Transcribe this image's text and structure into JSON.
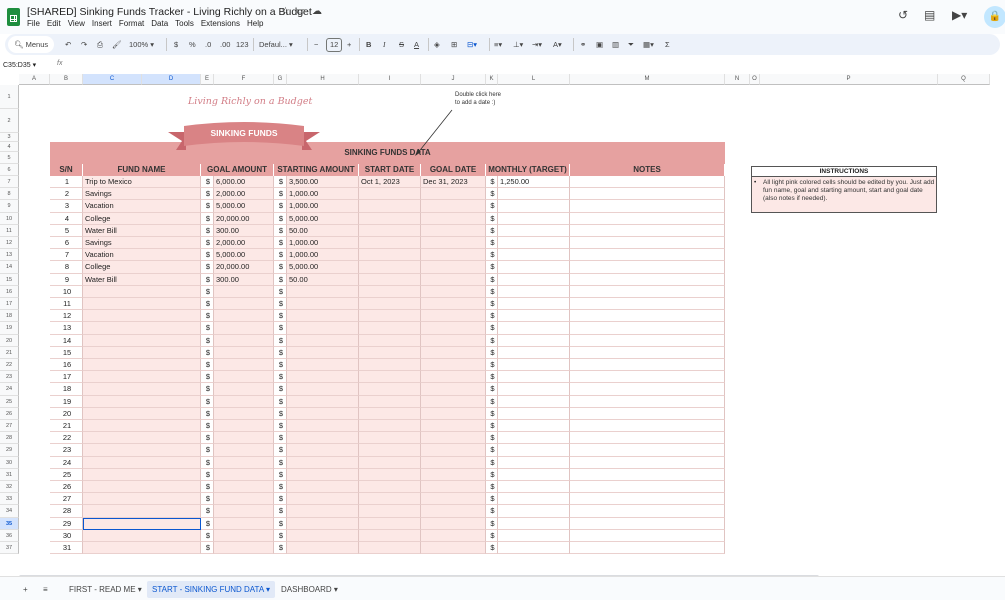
{
  "app": {
    "title": "[SHARED] Sinking Funds Tracker - Living Richly on a Budget",
    "menus": [
      "File",
      "Edit",
      "View",
      "Insert",
      "Format",
      "Data",
      "Tools",
      "Extensions",
      "Help"
    ]
  },
  "toolbar": {
    "menus_label": "Menus",
    "zoom": "100%",
    "currency": "$",
    "percent": "%",
    "dec_decrease": ".0",
    "dec_increase": ".00",
    "number_format": "123",
    "font": "Defaul...",
    "font_size": "12",
    "minus": "−",
    "plus": "+",
    "bold": "B",
    "italic": "I",
    "strike": "S",
    "text_color": "A",
    "sigma": "Σ"
  },
  "formula_bar": {
    "name_box": "C35:D35",
    "fx": "fx"
  },
  "columns": [
    "A",
    "B",
    "C",
    "D",
    "E",
    "F",
    "G",
    "H",
    "I",
    "J",
    "K",
    "L",
    "M",
    "N",
    "O",
    "P",
    "Q"
  ],
  "rows": [
    "1",
    "2",
    "3",
    "4",
    "5",
    "6",
    "7",
    "8",
    "9",
    "10",
    "11",
    "12",
    "13",
    "14",
    "15",
    "16",
    "17",
    "18",
    "19",
    "20",
    "21",
    "22",
    "23",
    "24",
    "25",
    "26",
    "27",
    "28",
    "29",
    "30",
    "31",
    "32",
    "33",
    "34",
    "35",
    "36",
    "37"
  ],
  "branding": {
    "logo": "Living Richly on a Budget",
    "banner": "SINKING FUNDS"
  },
  "annotation": {
    "line1": "Double click here",
    "line2": "to add a date :)"
  },
  "table": {
    "title": "SINKING FUNDS DATA",
    "headers": [
      "S/N",
      "FUND NAME",
      "GOAL AMOUNT",
      "STARTING AMOUNT",
      "START DATE",
      "GOAL DATE",
      "MONTHLY (TARGET)",
      "NOTES"
    ],
    "currency_symbol": "$",
    "rows": [
      {
        "sn": "1",
        "name": "Trip to Mexico",
        "goal": "6,000.00",
        "start_amt": "3,500.00",
        "start_date": "Oct 1, 2023",
        "goal_date": "Dec 31, 2023",
        "monthly": "1,250.00"
      },
      {
        "sn": "2",
        "name": "Savings",
        "goal": "2,000.00",
        "start_amt": "1,000.00"
      },
      {
        "sn": "3",
        "name": "Vacation",
        "goal": "5,000.00",
        "start_amt": "1,000.00"
      },
      {
        "sn": "4",
        "name": "College",
        "goal": "20,000.00",
        "start_amt": "5,000.00"
      },
      {
        "sn": "5",
        "name": "Water Bill",
        "goal": "300.00",
        "start_amt": "50.00"
      },
      {
        "sn": "6",
        "name": "Savings",
        "goal": "2,000.00",
        "start_amt": "1,000.00"
      },
      {
        "sn": "7",
        "name": "Vacation",
        "goal": "5,000.00",
        "start_amt": "1,000.00"
      },
      {
        "sn": "8",
        "name": "College",
        "goal": "20,000.00",
        "start_amt": "5,000.00"
      },
      {
        "sn": "9",
        "name": "Water Bill",
        "goal": "300.00",
        "start_amt": "50.00"
      },
      {
        "sn": "10"
      },
      {
        "sn": "11"
      },
      {
        "sn": "12"
      },
      {
        "sn": "13"
      },
      {
        "sn": "14"
      },
      {
        "sn": "15"
      },
      {
        "sn": "16"
      },
      {
        "sn": "17"
      },
      {
        "sn": "18"
      },
      {
        "sn": "19"
      },
      {
        "sn": "20"
      },
      {
        "sn": "21"
      },
      {
        "sn": "22"
      },
      {
        "sn": "23"
      },
      {
        "sn": "24"
      },
      {
        "sn": "25"
      },
      {
        "sn": "26"
      },
      {
        "sn": "27"
      },
      {
        "sn": "28"
      },
      {
        "sn": "29"
      },
      {
        "sn": "30"
      },
      {
        "sn": "31"
      }
    ]
  },
  "instructions": {
    "title": "INSTRUCTIONS",
    "text": "All light pink colored cells should be edited by you. Just add fun name, goal and starting amount, start and goal date (also notes if needed)."
  },
  "sheet_tabs": [
    {
      "label": "FIRST - READ ME",
      "active": false
    },
    {
      "label": "START - SINKING FUND DATA",
      "active": true
    },
    {
      "label": "DASHBOARD",
      "active": false
    }
  ],
  "colors": {
    "header_pink": "#e6a1a0",
    "cell_pink": "#fce8e6",
    "accent": "#0b57d0"
  }
}
